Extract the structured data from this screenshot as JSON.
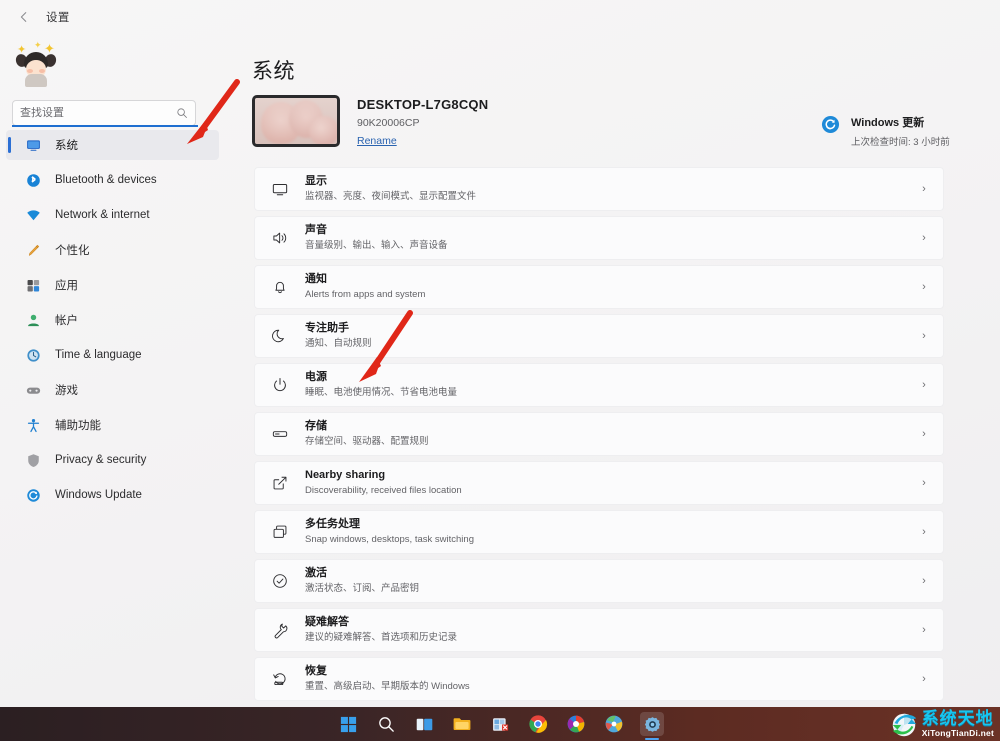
{
  "titlebar": {
    "back_icon": "back-arrow-icon",
    "title": "设置"
  },
  "sidebar": {
    "avatar": "user-avatar",
    "search": {
      "placeholder": "查找设置",
      "value": "",
      "icon": "search-icon"
    },
    "items": [
      {
        "label": "系统",
        "icon": "monitor-icon",
        "selected": true
      },
      {
        "label": "Bluetooth & devices",
        "icon": "bluetooth-icon",
        "selected": false
      },
      {
        "label": "Network & internet",
        "icon": "network-icon",
        "selected": false
      },
      {
        "label": "个性化",
        "icon": "brush-icon",
        "selected": false
      },
      {
        "label": "应用",
        "icon": "apps-icon",
        "selected": false
      },
      {
        "label": "帐户",
        "icon": "account-icon",
        "selected": false
      },
      {
        "label": "Time & language",
        "icon": "clock-icon",
        "selected": false
      },
      {
        "label": "游戏",
        "icon": "gamepad-icon",
        "selected": false
      },
      {
        "label": "辅助功能",
        "icon": "accessibility-icon",
        "selected": false
      },
      {
        "label": "Privacy & security",
        "icon": "shield-icon",
        "selected": false
      },
      {
        "label": "Windows Update",
        "icon": "update-icon",
        "selected": false
      }
    ]
  },
  "main": {
    "page_title": "系统",
    "device": {
      "name": "DESKTOP-L7G8CQN",
      "model": "90K20006CP",
      "rename_label": "Rename",
      "thumbnail": "device-wallpaper-thumbnail"
    },
    "windows_update": {
      "icon": "windows-update-icon",
      "title": "Windows 更新",
      "subtitle": "上次检查时间: 3 小时前"
    },
    "settings_items": [
      {
        "title": "显示",
        "subtitle": "监视器、亮度、夜间模式、显示配置文件",
        "icon": "monitor-icon"
      },
      {
        "title": "声音",
        "subtitle": "音量级别、输出、输入、声音设备",
        "icon": "speaker-icon"
      },
      {
        "title": "通知",
        "subtitle": "Alerts from apps and system",
        "icon": "bell-icon"
      },
      {
        "title": "专注助手",
        "subtitle": "通知、自动规则",
        "icon": "moon-icon"
      },
      {
        "title": "电源",
        "subtitle": "睡眠、电池使用情况、节省电池电量",
        "icon": "power-icon"
      },
      {
        "title": "存储",
        "subtitle": "存储空间、驱动器、配置规则",
        "icon": "storage-icon"
      },
      {
        "title": "Nearby sharing",
        "subtitle": "Discoverability, received files location",
        "icon": "share-icon"
      },
      {
        "title": "多任务处理",
        "subtitle": "Snap windows, desktops, task switching",
        "icon": "multitask-icon"
      },
      {
        "title": "激活",
        "subtitle": "激活状态、订阅、产品密钥",
        "icon": "check-circle-icon"
      },
      {
        "title": "疑难解答",
        "subtitle": "建议的疑难解答、首选项和历史记录",
        "icon": "wrench-icon"
      },
      {
        "title": "恢复",
        "subtitle": "重置、高级启动、早期版本的 Windows",
        "icon": "recovery-icon"
      }
    ],
    "chevron_glyph": "›"
  },
  "annotations": [
    {
      "name": "arrow-pointing-to-system-nav",
      "color": "#e02718"
    },
    {
      "name": "arrow-pointing-to-power-item",
      "color": "#e02718"
    }
  ],
  "taskbar": {
    "items": [
      {
        "name": "start-icon",
        "active": false
      },
      {
        "name": "search-icon",
        "active": false
      },
      {
        "name": "task-view-icon",
        "active": false
      },
      {
        "name": "file-explorer-icon",
        "active": false
      },
      {
        "name": "microsoft-store-icon",
        "active": false
      },
      {
        "name": "chrome-icon",
        "active": false
      },
      {
        "name": "browser-icon",
        "active": false
      },
      {
        "name": "paint-icon",
        "active": false
      },
      {
        "name": "settings-icon",
        "active": true
      }
    ]
  },
  "watermark": {
    "cn": "系统天地",
    "en": "XiTongTianDi.net",
    "icon": "globe-arrow-logo"
  }
}
